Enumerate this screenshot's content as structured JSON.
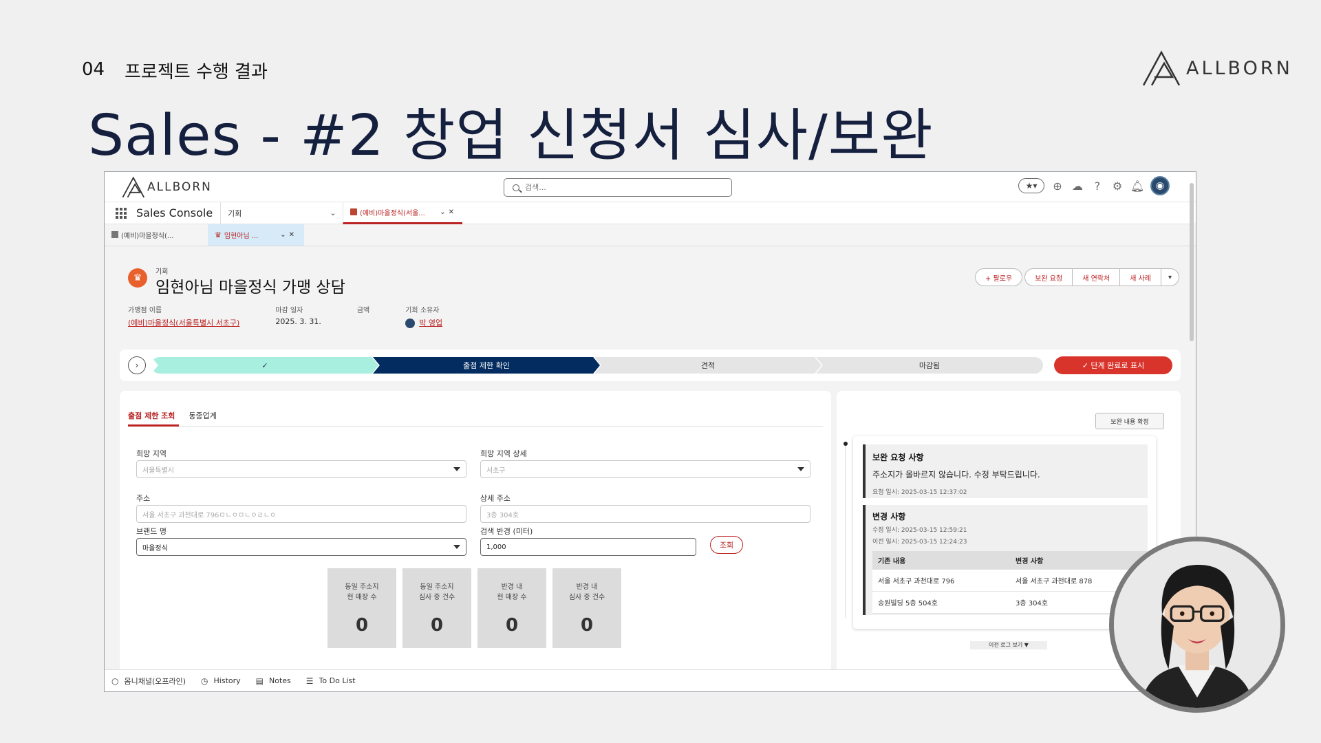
{
  "slide": {
    "number": "04",
    "section": "프로젝트 수행 결과",
    "title": "Sales - #2 창업 신청서 심사/보완",
    "brand": "ALLBORN"
  },
  "app": {
    "brand": "ALLBORN",
    "search_placeholder": "검색...",
    "app_name": "Sales Console",
    "object_nav": "기회",
    "workspace_tab": "(예비)마을정식(서울...",
    "subtabs": [
      {
        "label": "(예비)마을정식(..."
      },
      {
        "label": "임현아님 ..."
      }
    ]
  },
  "record": {
    "type": "기회",
    "title": "임현아님 마을정식 가맹 상담",
    "actions": {
      "follow": "+ 팔로우",
      "supplement": "보완 요청",
      "new_contact": "새 연락처",
      "new_case": "새 사례"
    },
    "fields": [
      {
        "label": "가맹점 이름",
        "value": "(예비)마을정식(서울특별시 서초구)"
      },
      {
        "label": "마감 일자",
        "value": "2025. 3. 31."
      },
      {
        "label": "금액",
        "value": ""
      },
      {
        "label": "기회 소유자",
        "value": "박 영업"
      }
    ]
  },
  "path": {
    "stages": [
      {
        "label": "✓",
        "status": "complete"
      },
      {
        "label": "출점 제한 확인",
        "status": "current"
      },
      {
        "label": "견적",
        "status": "upcoming"
      },
      {
        "label": "마감됨",
        "status": "upcoming"
      }
    ],
    "complete_button": "✓ 단계 완료로 표시"
  },
  "form": {
    "tabs": [
      "출점 제한 조회",
      "동종업계"
    ],
    "region_label": "희망 지역",
    "region_value": "서울특별시",
    "region_detail_label": "희망 지역 상세",
    "region_detail_value": "서초구",
    "address_label": "주소",
    "address_value": "서울 서초구 과천대로 796ㅁㄴㅇㅁㄴㅇㄹㄴㅇ",
    "address_detail_label": "상세 주소",
    "address_detail_value": "3층 304호",
    "brand_label": "브랜드 명",
    "brand_value": "마을정식",
    "radius_label": "검색 반경 (미터)",
    "radius_value": "1,000",
    "query_button": "조회",
    "stats": [
      {
        "label1": "동일 주소지",
        "label2": "현 매장 수",
        "value": "0"
      },
      {
        "label1": "동일 주소지",
        "label2": "심사 중 건수",
        "value": "0"
      },
      {
        "label1": "반경 내",
        "label2": "현 매장 수",
        "value": "0"
      },
      {
        "label1": "반경 내",
        "label2": "심사 중 건수",
        "value": "0"
      }
    ]
  },
  "feed": {
    "confirm_button": "보완 내용 확정",
    "request_title": "보완 요청 사항",
    "request_body": "주소지가 올바르지 않습니다. 수정 부탁드립니다.",
    "request_date": "요청 일시: 2025-03-15 12:37:02",
    "change_title": "변경 사항",
    "change_date_mod": "수정 일시: 2025-03-15 12:59:21",
    "change_date_prev": "이전 일시: 2025-03-15 12:24:23",
    "table_headers": [
      "기존 내용",
      "변경 사항"
    ],
    "table_rows": [
      [
        "서울 서초구 과천대로 796",
        "서울 서초구 과천대로 878"
      ],
      [
        "송원빌딩 5층 504호",
        "3층 304호"
      ]
    ],
    "older_link": "이전 로그 보기 ▼"
  },
  "footer": [
    {
      "icon": "○",
      "label": "옴니채널(오프라인)"
    },
    {
      "icon": "◷",
      "label": "History"
    },
    {
      "icon": "▤",
      "label": "Notes"
    },
    {
      "icon": "☰",
      "label": "To Do List"
    }
  ],
  "colors": {
    "brand_red": "#b22222",
    "path_complete": "#a8efe0",
    "path_current": "#032d60",
    "complete_button": "#d9342b",
    "title_navy": "#15203f"
  }
}
